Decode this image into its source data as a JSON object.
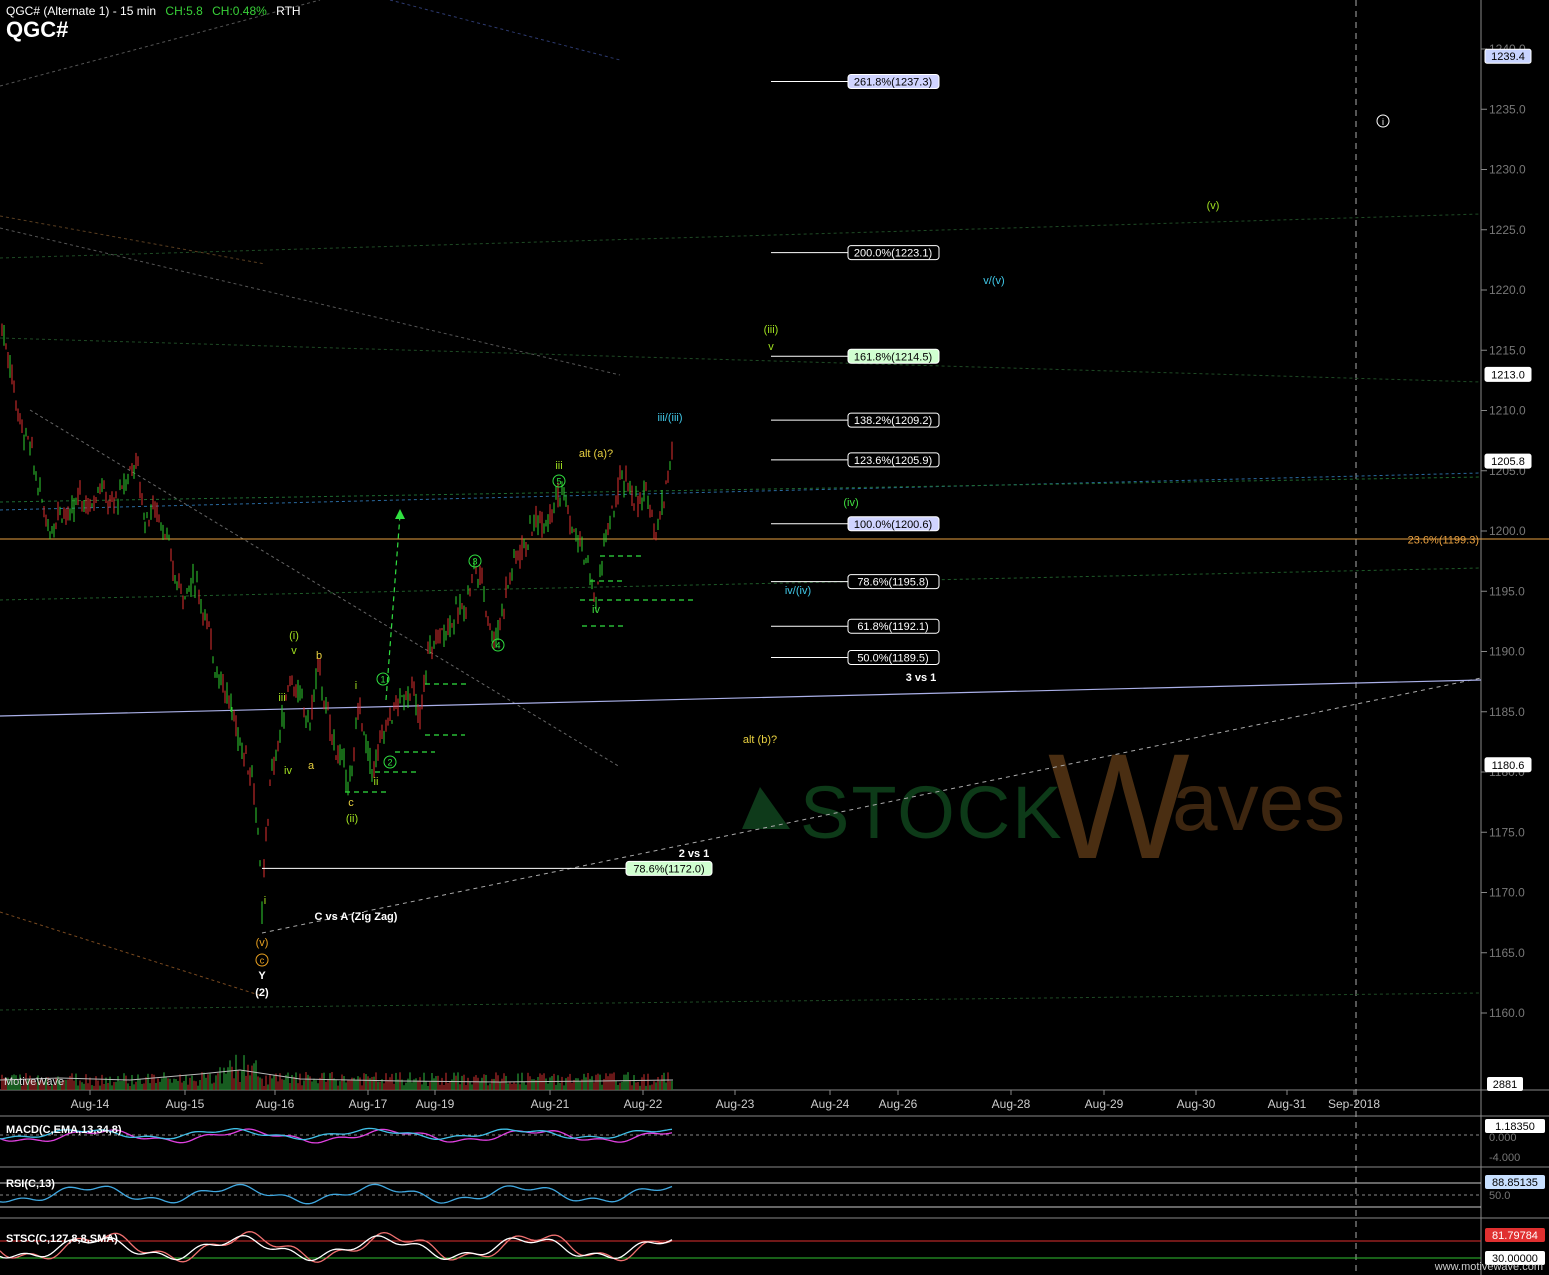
{
  "header": {
    "title": "QGC# (Alternate 1) - 15 min",
    "change": "CH:5.8",
    "change_pct": "CH:0.48%",
    "session": "RTH",
    "symbol": "QGC#"
  },
  "branding": {
    "motivewave": "MotiveWave",
    "site": "www.motivewave.com"
  },
  "axis": {
    "price_ticks": [
      "1240.0",
      "1235.0",
      "1230.0",
      "1225.0",
      "1220.0",
      "1215.0",
      "1210.0",
      "1205.0",
      "1200.0",
      "1195.0",
      "1190.0",
      "1185.0",
      "1180.0",
      "1175.0",
      "1170.0",
      "1165.0",
      "1160.0"
    ],
    "price_badges": [
      {
        "label": "1239.4",
        "value": 1239.4,
        "color": "#c8d4ff"
      },
      {
        "label": "1213.0",
        "value": 1213.0,
        "color": "#ffffff"
      },
      {
        "label": "1205.8",
        "value": 1205.8,
        "color": "#ffffff"
      },
      {
        "label": "1180.6",
        "value": 1180.6,
        "color": "#ffffff"
      }
    ],
    "volume_badge": "2881",
    "date_labels": [
      "Aug-14",
      "Aug-15",
      "Aug-16",
      "Aug-17",
      "Aug-19",
      "Aug-21",
      "Aug-22",
      "Aug-23",
      "Aug-24",
      "Aug-26",
      "Aug-28",
      "Aug-29",
      "Aug-30",
      "Aug-31",
      "Sep-2018"
    ]
  },
  "fib_levels": [
    {
      "label": "261.8%(1237.3)",
      "price": 1237.3,
      "bg": "#d0d4ff"
    },
    {
      "label": "200.0%(1223.1)",
      "price": 1223.1,
      "bg": "#000000"
    },
    {
      "label": "161.8%(1214.5)",
      "price": 1214.5,
      "bg": "#d0ffd0"
    },
    {
      "label": "138.2%(1209.2)",
      "price": 1209.2,
      "bg": "#000000"
    },
    {
      "label": "123.6%(1205.9)",
      "price": 1205.9,
      "bg": "#000000"
    },
    {
      "label": "100.0%(1200.6)",
      "price": 1200.6,
      "bg": "#d0d4ff"
    },
    {
      "label": "78.6%(1195.8)",
      "price": 1195.8,
      "bg": "#000000"
    },
    {
      "label": "61.8%(1192.1)",
      "price": 1192.1,
      "bg": "#000000"
    },
    {
      "label": "50.0%(1189.5)",
      "price": 1189.5,
      "bg": "#000000"
    }
  ],
  "fib_lower": {
    "label": "78.6%(1172.0)",
    "price": 1172.0
  },
  "retrace_label": {
    "label": "23.6%(1199.3)",
    "price": 1199.3
  },
  "annotations": [
    {
      "text": "3 vs 1",
      "color": "#ffffff",
      "bold": true
    },
    {
      "text": "2 vs 1",
      "color": "#ffffff",
      "bold": true
    },
    {
      "text": "C vs A (Zig Zag)",
      "color": "#ffffff",
      "bold": true
    },
    {
      "text": "alt (a)?",
      "color": "#e8d040"
    },
    {
      "text": "alt (b)?",
      "color": "#e8d040"
    },
    {
      "text": "(iii)",
      "color": "#a0e020"
    },
    {
      "text": "v",
      "color": "#a0e020"
    },
    {
      "text": "iii/(iii)",
      "color": "#40c8e8"
    },
    {
      "text": "v/(v)",
      "color": "#40c8e8"
    },
    {
      "text": "iv/(iv)",
      "color": "#40c8e8"
    },
    {
      "text": "(v)",
      "color": "#a0e020"
    },
    {
      "text": "(iv)",
      "color": "#40e040"
    },
    {
      "text": "iii",
      "color": "#a0e020"
    },
    {
      "text": "iv",
      "color": "#40e040"
    },
    {
      "text": "(i)",
      "color": "#a0e020"
    },
    {
      "text": "v",
      "color": "#a0e020"
    },
    {
      "text": "b",
      "color": "#e8d040"
    },
    {
      "text": "iii",
      "color": "#a0e020"
    },
    {
      "text": "iv",
      "color": "#a0e020"
    },
    {
      "text": "a",
      "color": "#e8d040"
    },
    {
      "text": "i",
      "color": "#a0e020"
    },
    {
      "text": "ii",
      "color": "#a0e020"
    },
    {
      "text": "c",
      "color": "#e8d040"
    },
    {
      "text": "(ii)",
      "color": "#a0e020"
    },
    {
      "text": "i",
      "color": "#a0e020"
    },
    {
      "text": "(v)",
      "color": "#e8a020"
    },
    {
      "text": "Y",
      "color": "#ffffff",
      "bold": true
    },
    {
      "text": "(2)",
      "color": "#ffffff",
      "bold": true
    }
  ],
  "circled_labels": [
    "1",
    "2",
    "3",
    "4",
    "5",
    "c"
  ],
  "indicators": {
    "macd": {
      "title": "MACD(C,EMA,13,34,8)",
      "value_badge": "1.18350",
      "ticks": [
        "0.000",
        "-4.000"
      ]
    },
    "rsi": {
      "title": "RSI(C,13)",
      "value_badge": "88.85135",
      "ticks": [
        "50.0"
      ]
    },
    "stoch": {
      "title": "STSC(C,127,8,8,SMA)",
      "value_badge": "81.79784",
      "value_badge2": "30.00000"
    }
  },
  "logo": {
    "left_word": "STOCK",
    "right_word": "aves",
    "initial": "W"
  }
}
